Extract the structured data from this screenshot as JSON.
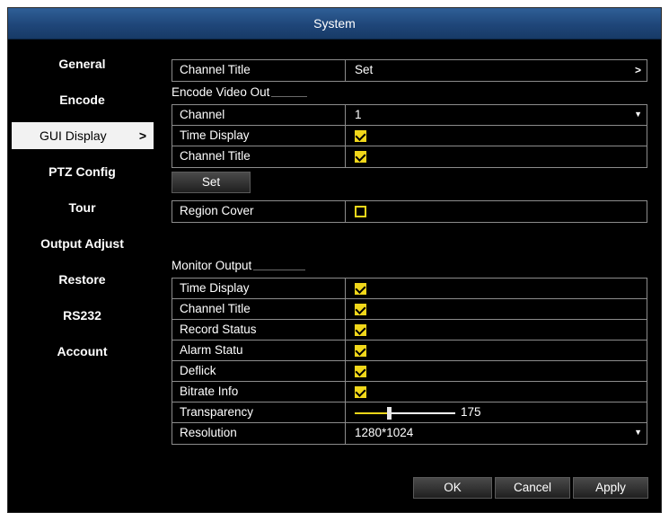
{
  "window": {
    "title": "System"
  },
  "sidebar": {
    "items": [
      {
        "label": "General"
      },
      {
        "label": "Encode"
      },
      {
        "label": "GUI Display",
        "active": true
      },
      {
        "label": "PTZ Config"
      },
      {
        "label": "Tour"
      },
      {
        "label": "Output Adjust"
      },
      {
        "label": "Restore"
      },
      {
        "label": "RS232"
      },
      {
        "label": "Account"
      }
    ],
    "active_arrow": ">"
  },
  "top": {
    "channel_title_label": "Channel Title",
    "channel_title_value": "Set",
    "chevron": ">"
  },
  "encode": {
    "section_label": "Encode Video Out",
    "channel_label": "Channel",
    "channel_value": "1",
    "time_display_label": "Time Display",
    "time_display_checked": true,
    "channel_title_label": "Channel Title",
    "channel_title_checked": true,
    "set_button": "Set",
    "region_cover_label": "Region Cover",
    "region_cover_checked": false
  },
  "monitor": {
    "section_label": "Monitor Output",
    "rows": [
      {
        "label": "Time Display",
        "checked": true
      },
      {
        "label": "Channel Title",
        "checked": true
      },
      {
        "label": "Record Status",
        "checked": true
      },
      {
        "label": "Alarm Statu",
        "checked": true
      },
      {
        "label": "Deflick",
        "checked": true
      },
      {
        "label": "Bitrate Info",
        "checked": true
      }
    ],
    "transparency_label": "Transparency",
    "transparency_value": "175",
    "resolution_label": "Resolution",
    "resolution_value": "1280*1024"
  },
  "footer": {
    "ok": "OK",
    "cancel": "Cancel",
    "apply": "Apply"
  },
  "colors": {
    "titlebar": "#1f4679",
    "checkbox": "#f1d71a",
    "background": "#000000"
  }
}
